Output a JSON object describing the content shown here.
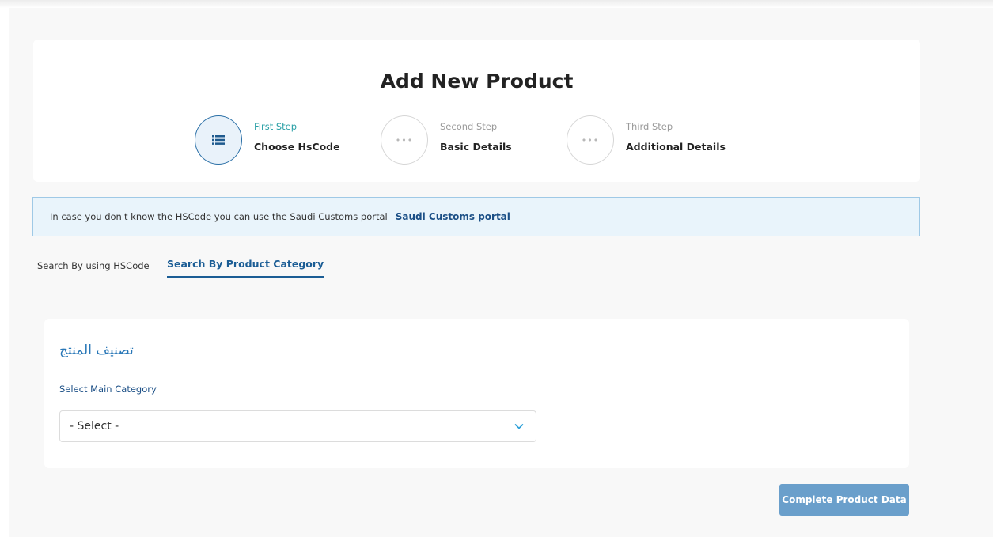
{
  "page": {
    "title": "Add New Product"
  },
  "steps": [
    {
      "label": "First Step",
      "title": "Choose HsCode",
      "icon": "list-icon",
      "active": true
    },
    {
      "label": "Second Step",
      "title": "Basic Details",
      "icon": "ellipsis-icon",
      "active": false
    },
    {
      "label": "Third Step",
      "title": "Additional Details",
      "icon": "ellipsis-icon",
      "active": false
    }
  ],
  "info": {
    "text": "In case you don't know the HSCode you can use the Saudi Customs portal",
    "link_label": "Saudi Customs portal"
  },
  "tabs": [
    {
      "label": "Search By using HSCode",
      "active": false
    },
    {
      "label": "Search By Product Category",
      "active": true
    }
  ],
  "category": {
    "heading": "تصنيف المنتج",
    "main_label": "Select Main Category",
    "select_value": "- Select -"
  },
  "actions": {
    "complete_label": "Complete Product Data"
  },
  "colors": {
    "accent": "#1b5d95",
    "button": "#6a9fcb",
    "info_bg": "#e9f4fb"
  }
}
